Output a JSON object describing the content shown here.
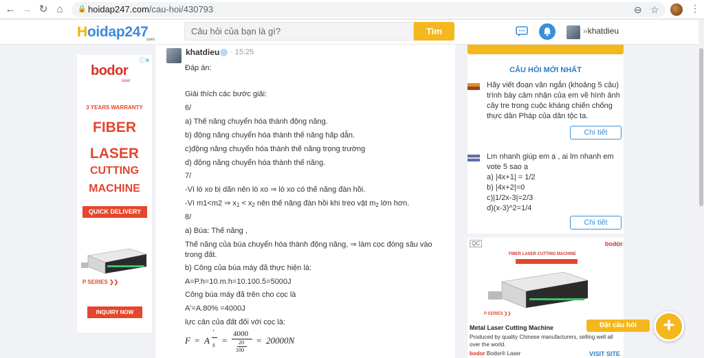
{
  "browser": {
    "url_host": "hoidap247.com",
    "url_path": "/cau-hoi/430793",
    "back_icon": "←",
    "forward_icon": "→",
    "reload_icon": "↻",
    "home_icon": "⌂",
    "zoom_icon": "⊖",
    "star_icon": "☆",
    "menu_icon": "⋮"
  },
  "header": {
    "logo_h": "H",
    "logo_rest": "oidap247",
    "logo_com": ".com",
    "search_placeholder": "Câu hỏi của bạn là gì?",
    "search_button": "Tìm",
    "username": "khatdieu",
    "user_caret": "»"
  },
  "ad_left": {
    "brand": "bodor",
    "brand_sub": "laser",
    "warranty": "3 YEARS WARRANTY",
    "line1": "FIBER",
    "line2": "LASER",
    "line3": "CUTTING",
    "line4": "MACHINE",
    "quick": "QUICK DELIVERY",
    "series": "P SERIES ❯❯",
    "inquiry": "INQUIRY NOW",
    "close": "ⓘ✕"
  },
  "answer": {
    "username": "khatdieu",
    "time": "· 15:25",
    "lines": [
      "Đáp án:",
      "Giải thích các bước giải:",
      " 6/",
      "a) Thế năng chuyển hóa thành động năng.",
      "b) động năng chuyển hóa thành thế năng hấp dẫn.",
      "c)động năng chuyển hóa thành thế năng trọng trường",
      "d) động năng chuyển hóa thành thế năng.",
      "7/",
      "-Vì lò xo bị dãn nên lò xo  ⇒  lò xo có thế năng đàn hồi.",
      "8/",
      "a) Búa: Thế năng ,",
      "b) Công của búa máy đã thực hiện là:",
      "A=P.h=10.m.h=10.100.5=5000J",
      "Công búa máy đã trên cho cọc là",
      "A'=A.80% =4000J",
      "lực cản của đất đối với cọc là:"
    ],
    "line_m1": "-Vì m1<m2  ⇒  x",
    "line_m1_sub1": "1",
    "line_m1_mid": " < x",
    "line_m1_sub2": "2",
    "line_m1_end": " nên thế năng đàn hồi khi treo vật m",
    "line_m1_sub3": "2",
    "line_m1_tail": " lớn hơn.",
    "wrap_line": "Thế năng của búa chuyển hóa thành động năng,  ⇒  làm cọc đóng sâu vào trong đất.",
    "formula": {
      "lhs": "F",
      "eq1": "=",
      "a": "A",
      "prime": "′",
      "s": "s",
      "eq2": "=",
      "num": "4000",
      "den_num": "20",
      "den_den": "100",
      "eq3": "=",
      "result": "20000N"
    }
  },
  "sidebar": {
    "title": "CÂU HỎI MỚI NHẤT",
    "questions": [
      {
        "text": "Hãy viết đoạn văn ngắn (khoảng 5 câu) trình bày cảm nhận của em về hình ảnh cây tre trong cuộc kháng chiến chống thực dân Pháp của dân tộc ta.",
        "button": "Chi tiết"
      },
      {
        "lines": [
          "Lm nhanh giúp em ạ , ai lm nhanh em vote 5 sao ạ",
          "a) |4x+1| = 1/2",
          "b) |4x+2|=0",
          "c)|1/2x-3|=2/3",
          "d)(x-3)^2=1/4"
        ],
        "button": "Chi tiết"
      }
    ]
  },
  "ad_right": {
    "qc": "QC",
    "brand": "bodor",
    "close": "ⓘ✕",
    "title": "Metal Laser Cutting Machine",
    "desc": "Produced by quality Chinese manufacturers, selling well all over the world.",
    "advertiser": "Bodor® Laser",
    "advertiser_logo": "bodor",
    "visit": "VISIT SITE",
    "banner_head": "FIBER LASER CUTTING MACHINE",
    "banner_series": "P SERIES ❯❯"
  },
  "floating": {
    "label": "Đặt câu hỏi",
    "plus": "+"
  }
}
